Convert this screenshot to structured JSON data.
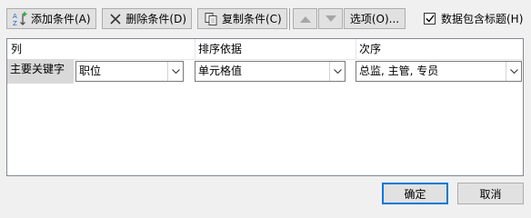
{
  "toolbar": {
    "add_label": "添加条件(A)",
    "delete_label": "删除条件(D)",
    "copy_label": "复制条件(C)",
    "options_label": "选项(O)...",
    "header_checkbox_label": "数据包含标题(H)",
    "header_checkbox_checked": true
  },
  "grid": {
    "headers": {
      "column": "列",
      "sort_on": "排序依据",
      "order": "次序"
    },
    "rows": [
      {
        "key_label": "主要关键字",
        "column": "职位",
        "sort_on": "单元格值",
        "order": "总监, 主管, 专员"
      }
    ]
  },
  "footer": {
    "ok_label": "确定",
    "cancel_label": "取消"
  },
  "colors": {
    "focus_blue": "#0078d7",
    "button_face": "#e1e1e1",
    "dialog_bg": "#f0f0f0"
  }
}
